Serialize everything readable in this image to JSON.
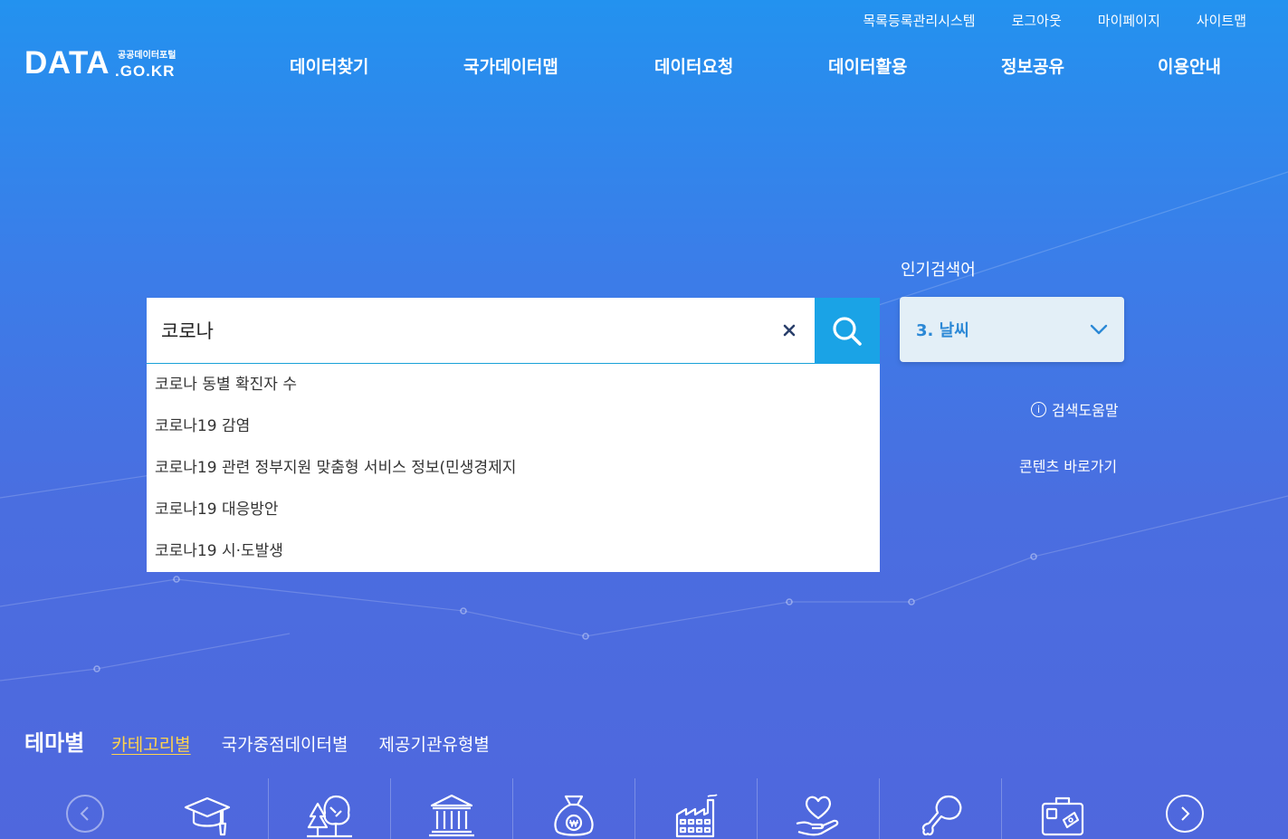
{
  "colors": {
    "bg_top": "#2392ef",
    "bg_bottom": "#4f67dd",
    "search_button": "#1aa3e6",
    "popular_keyword": "#2b88d6",
    "active_tab": "#ffd34d"
  },
  "util_nav": [
    "목록등록관리시스템",
    "로그아웃",
    "마이페이지",
    "사이트맵"
  ],
  "logo": {
    "main": "DATA",
    "sub": "공공데이터포털",
    "domain": ".GO.KR"
  },
  "main_nav": [
    "데이터찾기",
    "국가데이터맵",
    "데이터요청",
    "데이터활용",
    "정보공유",
    "이용안내"
  ],
  "search": {
    "value": "코로나",
    "suggestions": [
      "코로나 동별 확진자 수",
      "코로나19 감염",
      "코로나19 관련 정부지원 맞춤형 서비스 정보(민생경제지",
      "코로나19 대응방안",
      "코로나19 시·도발생"
    ]
  },
  "popular": {
    "label": "인기검색어",
    "current": "3. 날씨"
  },
  "help_link": "검색도움말",
  "content_link": "콘텐츠 바로가기",
  "theme": {
    "title": "테마별",
    "tabs": [
      "카테고리별",
      "국가중점데이터별",
      "제공기관유형별"
    ],
    "active_tab": "카테고리별"
  },
  "categories": [
    {
      "icon": "graduation-cap-icon"
    },
    {
      "icon": "trees-icon"
    },
    {
      "icon": "government-building-icon"
    },
    {
      "icon": "money-bag-icon"
    },
    {
      "icon": "factory-icon"
    },
    {
      "icon": "heart-hand-icon"
    },
    {
      "icon": "chicken-leg-icon"
    },
    {
      "icon": "travel-bag-icon"
    }
  ]
}
